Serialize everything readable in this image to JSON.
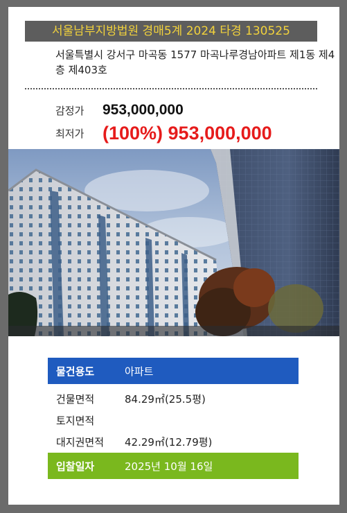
{
  "court": {
    "title": "서울남부지방법원 경매5계 2024 타경 130525"
  },
  "property": {
    "address": "서울특별시 강서구 마곡동 1577 마곡나루경남아파트 제1동 제4층 제403호"
  },
  "prices": {
    "appraisal_label": "감정가",
    "appraisal_value": "953,000,000",
    "minimum_label": "최저가",
    "minimum_value": "(100%) 953,000,000"
  },
  "details": [
    {
      "label": "물건용도",
      "value": "아파트"
    },
    {
      "label": "건물면적",
      "value": "84.29㎡(25.5평)"
    },
    {
      "label": "토지면적",
      "value": ""
    },
    {
      "label": "대지권면적",
      "value": "42.29㎡(12.79평)"
    },
    {
      "label": "입찰일자",
      "value": "2025년 10월 16일"
    }
  ],
  "colors": {
    "court_bar_bg": "#5d5d5d",
    "court_bar_text": "#f2d23c",
    "minimum_price": "#e61b1b",
    "usage_row": "#1f5bbf",
    "bid_date_row": "#7ab81e"
  },
  "photo": {
    "subject": "apartment-building-photo"
  }
}
